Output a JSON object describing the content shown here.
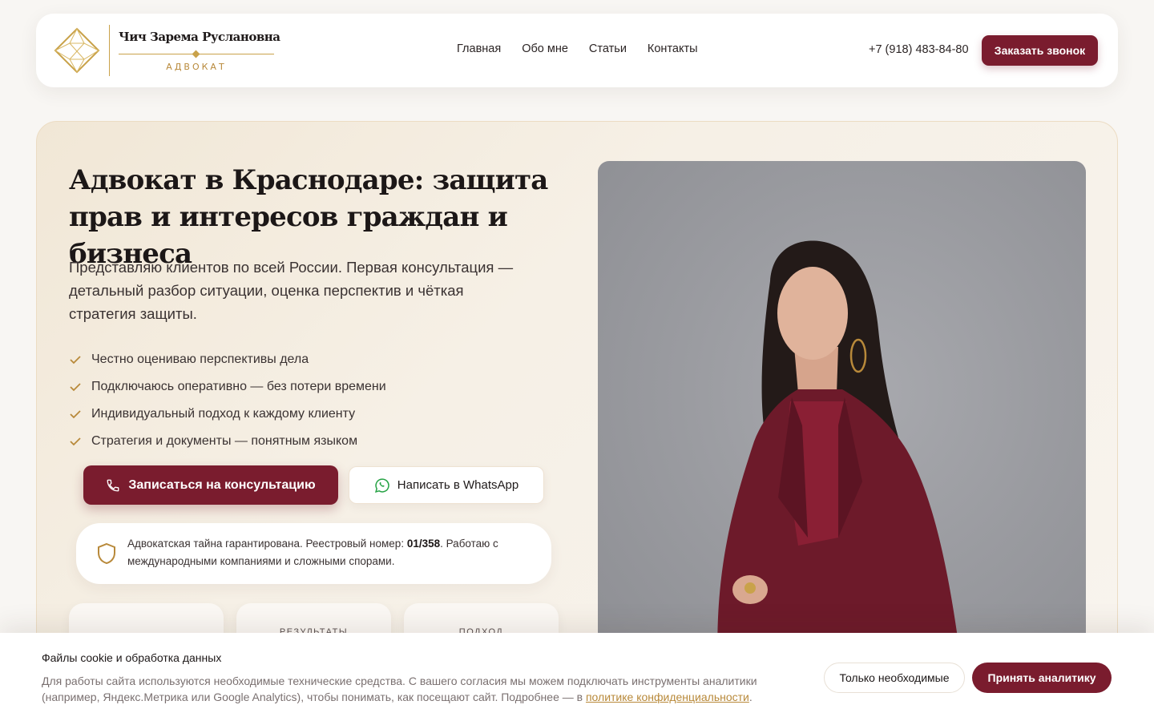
{
  "header": {
    "logo_name": "Чич Зарема Руслановна",
    "logo_subtitle": "АДВОКАТ",
    "nav": [
      {
        "label": "Главная"
      },
      {
        "label": "Обо мне"
      },
      {
        "label": "Статьи"
      },
      {
        "label": "Контакты"
      }
    ],
    "phone": "+7 (918) 483-84-80",
    "call_button": "Заказать звонок"
  },
  "hero": {
    "title": "Адвокат в Краснодаре: защита прав и интересов граждан и бизнеса",
    "lead": "Представляю клиентов по всей России. Первая консультация — детальный разбор ситуации, оценка перспектив и чёткая стратегия защиты.",
    "checklist": [
      "Честно оцениваю перспективы дела",
      "Подключаюсь оперативно — без потери времени",
      "Индивидуальный подход к каждому клиенту",
      "Стратегия и документы — понятным языком"
    ],
    "consult_button": "Записаться на консультацию",
    "whatsapp_button": "Написать в WhatsApp",
    "trust_text_before": "Адвокатская тайна гарантирована. Реестровый номер: ",
    "trust_number": "01/358",
    "trust_text_after": ". Работаю с международными компаниями и сложными спорами.",
    "stat_cards": [
      {
        "label": ""
      },
      {
        "label": "РЕЗУЛЬТАТЫ"
      },
      {
        "label": "ПОДХОД"
      }
    ]
  },
  "cookie": {
    "title": "Файлы cookie и обработка данных",
    "text": "Для работы сайта используются необходимые технические средства. С вашего согласия мы можем подключать инструменты аналитики (например, Яндекс.Метрика или Google Analytics), чтобы понимать, как посещают сайт. Подробнее — в ",
    "link": "политике конфиденциальности",
    "text_end": ".",
    "necessary_button": "Только необходимые",
    "accept_button": "Принять аналитику"
  },
  "colors": {
    "brand": "#7a1c2e",
    "gold": "#c9a24a",
    "background": "#f8f6f3"
  }
}
